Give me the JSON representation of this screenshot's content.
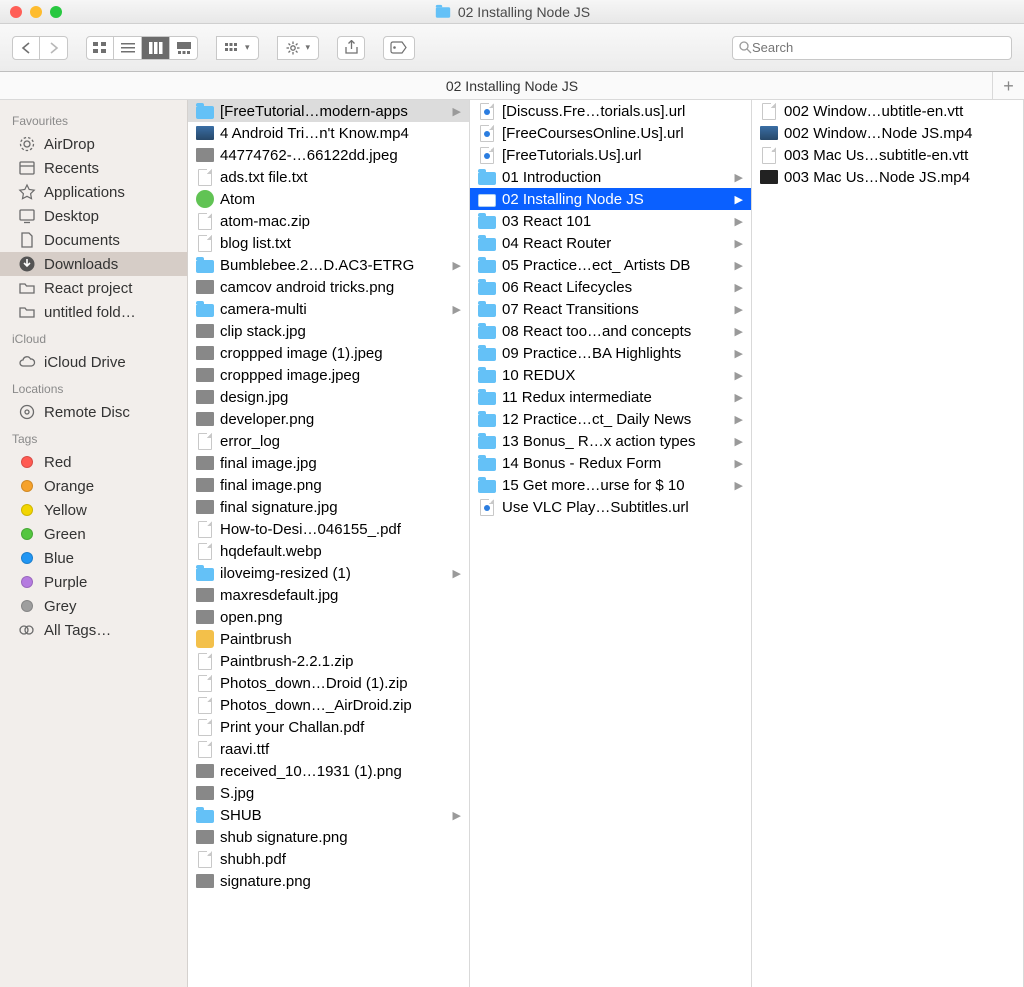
{
  "window": {
    "title": "02 Installing Node JS"
  },
  "toolbar": {
    "search_placeholder": "Search"
  },
  "pathbar": {
    "title": "02 Installing Node JS"
  },
  "sidebar": {
    "sections": [
      {
        "title": "Favourites",
        "items": [
          {
            "name": "AirDrop",
            "icon": "airdrop"
          },
          {
            "name": "Recents",
            "icon": "recents"
          },
          {
            "name": "Applications",
            "icon": "apps"
          },
          {
            "name": "Desktop",
            "icon": "desktop"
          },
          {
            "name": "Documents",
            "icon": "documents"
          },
          {
            "name": "Downloads",
            "icon": "downloads",
            "selected": true
          },
          {
            "name": "React project",
            "icon": "folder"
          },
          {
            "name": "untitled fold…",
            "icon": "folder"
          }
        ]
      },
      {
        "title": "iCloud",
        "items": [
          {
            "name": "iCloud Drive",
            "icon": "cloud"
          }
        ]
      },
      {
        "title": "Locations",
        "items": [
          {
            "name": "Remote Disc",
            "icon": "disc"
          }
        ]
      },
      {
        "title": "Tags",
        "items": [
          {
            "name": "Red",
            "color": "#ff5a52"
          },
          {
            "name": "Orange",
            "color": "#f6a22b"
          },
          {
            "name": "Yellow",
            "color": "#f2d500"
          },
          {
            "name": "Green",
            "color": "#54c63f"
          },
          {
            "name": "Blue",
            "color": "#2196f3"
          },
          {
            "name": "Purple",
            "color": "#b57be0"
          },
          {
            "name": "Grey",
            "color": "#9e9e9e"
          },
          {
            "name": "All Tags…",
            "icon": "alltags"
          }
        ]
      }
    ]
  },
  "columns": {
    "col1": [
      {
        "name": "[FreeTutorial…modern-apps",
        "type": "folder",
        "chev": true,
        "sel": "grey"
      },
      {
        "name": "4 Android Tri…n't Know.mp4",
        "type": "vid"
      },
      {
        "name": "44774762-…66122dd.jpeg",
        "type": "img"
      },
      {
        "name": "ads.txt file.txt",
        "type": "doc"
      },
      {
        "name": "Atom",
        "type": "app-green"
      },
      {
        "name": "atom-mac.zip",
        "type": "zip"
      },
      {
        "name": "blog list.txt",
        "type": "doc"
      },
      {
        "name": "Bumblebee.2…D.AC3-ETRG",
        "type": "folder",
        "chev": true
      },
      {
        "name": "camcov android tricks.png",
        "type": "img"
      },
      {
        "name": "camera-multi",
        "type": "folder",
        "chev": true
      },
      {
        "name": "clip stack.jpg",
        "type": "img"
      },
      {
        "name": "croppped image (1).jpeg",
        "type": "img"
      },
      {
        "name": "croppped image.jpeg",
        "type": "img"
      },
      {
        "name": "design.jpg",
        "type": "img"
      },
      {
        "name": "developer.png",
        "type": "img"
      },
      {
        "name": "error_log",
        "type": "doc"
      },
      {
        "name": "final image.jpg",
        "type": "img"
      },
      {
        "name": "final image.png",
        "type": "img"
      },
      {
        "name": "final signature.jpg",
        "type": "img"
      },
      {
        "name": "How-to-Desi…046155_.pdf",
        "type": "doc"
      },
      {
        "name": "hqdefault.webp",
        "type": "doc"
      },
      {
        "name": "iloveimg-resized (1)",
        "type": "folder",
        "chev": true
      },
      {
        "name": "maxresdefault.jpg",
        "type": "img"
      },
      {
        "name": "open.png",
        "type": "img"
      },
      {
        "name": "Paintbrush",
        "type": "app-pb"
      },
      {
        "name": "Paintbrush-2.2.1.zip",
        "type": "zip"
      },
      {
        "name": "Photos_down…Droid (1).zip",
        "type": "zip"
      },
      {
        "name": "Photos_down…_AirDroid.zip",
        "type": "zip"
      },
      {
        "name": "Print your Challan.pdf",
        "type": "doc"
      },
      {
        "name": "raavi.ttf",
        "type": "doc"
      },
      {
        "name": "received_10…1931 (1).png",
        "type": "img"
      },
      {
        "name": "S.jpg",
        "type": "img"
      },
      {
        "name": "SHUB",
        "type": "folder",
        "chev": true
      },
      {
        "name": "shub signature.png",
        "type": "img"
      },
      {
        "name": "shubh.pdf",
        "type": "doc"
      },
      {
        "name": "signature.png",
        "type": "img"
      }
    ],
    "col2": [
      {
        "name": "[Discuss.Fre…torials.us].url",
        "type": "url"
      },
      {
        "name": "[FreeCoursesOnline.Us].url",
        "type": "url"
      },
      {
        "name": "[FreeTutorials.Us].url",
        "type": "url"
      },
      {
        "name": "01 Introduction",
        "type": "folder",
        "chev": true
      },
      {
        "name": "02 Installing Node JS",
        "type": "folder",
        "chev": true,
        "sel": "blue"
      },
      {
        "name": "03 React 101",
        "type": "folder",
        "chev": true
      },
      {
        "name": "04 React Router",
        "type": "folder",
        "chev": true
      },
      {
        "name": "05 Practice…ect_ Artists DB",
        "type": "folder",
        "chev": true
      },
      {
        "name": "06 React Lifecycles",
        "type": "folder",
        "chev": true
      },
      {
        "name": "07 React Transitions",
        "type": "folder",
        "chev": true
      },
      {
        "name": "08 React too…and concepts",
        "type": "folder",
        "chev": true
      },
      {
        "name": "09 Practice…BA Highlights",
        "type": "folder",
        "chev": true
      },
      {
        "name": "10 REDUX",
        "type": "folder",
        "chev": true
      },
      {
        "name": "11 Redux intermediate",
        "type": "folder",
        "chev": true
      },
      {
        "name": "12 Practice…ct_ Daily News",
        "type": "folder",
        "chev": true
      },
      {
        "name": "13 Bonus_ R…x action types",
        "type": "folder",
        "chev": true
      },
      {
        "name": "14 Bonus - Redux Form",
        "type": "folder",
        "chev": true
      },
      {
        "name": "15 Get more…urse for $ 10",
        "type": "folder",
        "chev": true
      },
      {
        "name": "Use VLC Play…Subtitles.url",
        "type": "url"
      }
    ],
    "col3": [
      {
        "name": "002 Window…ubtitle-en.vtt",
        "type": "doc"
      },
      {
        "name": "002 Window…Node JS.mp4",
        "type": "vid"
      },
      {
        "name": "003 Mac Us…subtitle-en.vtt",
        "type": "doc"
      },
      {
        "name": "003 Mac Us…Node JS.mp4",
        "type": "vid-bw"
      }
    ]
  }
}
